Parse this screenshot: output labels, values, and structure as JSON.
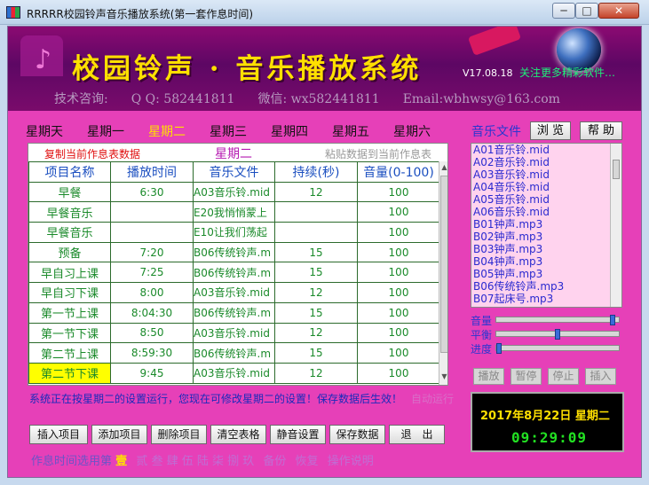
{
  "window": {
    "title": "RRRRR校园铃声音乐播放系统(第一套作息时间)",
    "min": "─",
    "max": "□",
    "close": "✕"
  },
  "banner": {
    "title": "校园铃声 · 音乐播放系统",
    "version": "V17.08.18",
    "news": "关注更多精彩软件…",
    "consult": "技术咨询:",
    "qq": "Q Q: 582441811",
    "wechat": "微信: wx582441811",
    "email": "Email:wbhwsy@163.com"
  },
  "days": [
    "星期天",
    "星期一",
    "星期二",
    "星期三",
    "星期四",
    "星期五",
    "星期六"
  ],
  "active_day_index": 2,
  "table": {
    "copy_label": "复制当前作息表数据",
    "caption": "星期二",
    "paste_label": "粘贴数据到当前作息表",
    "headers": [
      "项目名称",
      "播放时间",
      "音乐文件",
      "持续(秒)",
      "音量(0-100)"
    ],
    "rows": [
      [
        "早餐",
        "6:30",
        "A03音乐铃.mid",
        "12",
        "100"
      ],
      [
        "早餐音乐",
        "",
        "E20我悄悄蒙上",
        "",
        "100"
      ],
      [
        "早餐音乐",
        "",
        "E10让我们荡起",
        "",
        "100"
      ],
      [
        "预备",
        "7:20",
        "B06传统铃声.m",
        "15",
        "100"
      ],
      [
        "早自习上课",
        "7:25",
        "B06传统铃声.m",
        "15",
        "100"
      ],
      [
        "早自习下课",
        "8:00",
        "A03音乐铃.mid",
        "12",
        "100"
      ],
      [
        "第一节上课",
        "8:04:30",
        "B06传统铃声.m",
        "15",
        "100"
      ],
      [
        "第一节下课",
        "8:50",
        "A03音乐铃.mid",
        "12",
        "100"
      ],
      [
        "第二节上课",
        "8:59:30",
        "B06传统铃声.m",
        "15",
        "100"
      ],
      [
        "第二节下课",
        "9:45",
        "A03音乐铃.mid",
        "12",
        "100"
      ]
    ]
  },
  "status": {
    "message": "系统正在按星期二的设置运行，您现在可修改星期二的设置！保存数据后生效！",
    "faint": "自动运行"
  },
  "buttons": [
    "插入项目",
    "添加项目",
    "删除项目",
    "清空表格",
    "静音设置",
    "保存数据",
    "退　出"
  ],
  "schedule": {
    "label": "作息时间选用第",
    "current": "壹",
    "others": "贰 叁 肆 伍 陆 柒 捌 玖",
    "extra1": "备份",
    "extra2": "恢复",
    "extra3": "操作说明"
  },
  "music": {
    "label": "音乐文件",
    "browse": "浏 览",
    "help": "帮 助",
    "files": [
      "A01音乐铃.mid",
      "A02音乐铃.mid",
      "A03音乐铃.mid",
      "A04音乐铃.mid",
      "A05音乐铃.mid",
      "A06音乐铃.mid",
      "B01钟声.mp3",
      "B02钟声.mp3",
      "B03钟声.mp3",
      "B04钟声.mp3",
      "B05钟声.mp3",
      "B06传统铃声.mp3",
      "B07起床号.mp3"
    ]
  },
  "sliders": {
    "volume_label": "音量",
    "balance_label": "平衡",
    "progress_label": "进度",
    "volume_level": 0.97,
    "balance_level": 0.5,
    "progress_level": 0.0
  },
  "controls": [
    "播放",
    "暂停",
    "停止",
    "插入"
  ],
  "clock": {
    "date": "2017年8月22日 星期二",
    "time": "09:29:09"
  },
  "colors": {
    "background": "#e640b8",
    "accent_yellow": "#ffe000",
    "clock_green": "#22e022"
  }
}
